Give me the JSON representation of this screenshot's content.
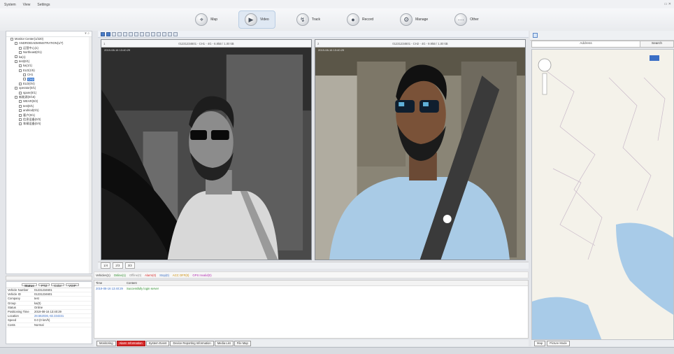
{
  "menu": {
    "items": [
      "System",
      "View",
      "Settings"
    ]
  },
  "nav": {
    "tabs": [
      {
        "label": "Map",
        "icon": "map-icon"
      },
      {
        "label": "Video",
        "icon": "video-icon",
        "active": true
      },
      {
        "label": "Track",
        "icon": "track-icon"
      },
      {
        "label": "Record",
        "icon": "record-icon"
      },
      {
        "label": "Manage",
        "icon": "manage-icon"
      },
      {
        "label": "Other",
        "icon": "other-icon"
      }
    ]
  },
  "tree": {
    "rows": [
      {
        "text": "Monitor Center(1/220)",
        "indent": 1
      },
      {
        "text": "ANDROIDADMINISTRATION(1/7)",
        "indent": 2
      },
      {
        "text": "运营中心(1)",
        "indent": 3
      },
      {
        "text": "Northeast(0/1)",
        "indent": 3
      },
      {
        "text": "ka(1)",
        "indent": 2
      },
      {
        "text": "test(0/1)",
        "indent": 2
      },
      {
        "text": "ka(1/1)",
        "indent": 3
      },
      {
        "text": "ELD(1/5)",
        "indent": 3
      },
      {
        "text": "CH1",
        "indent": 4
      },
      {
        "text": "CH2",
        "indent": 4,
        "selected": true
      },
      {
        "text": "ELD(0/4)",
        "indent": 3
      },
      {
        "text": "operator(0/1)",
        "indent": 2
      },
      {
        "text": "spare(0/1)",
        "indent": 3
      },
      {
        "text": "新能源(0/16)",
        "indent": 2
      },
      {
        "text": "WEAR(0/2)",
        "indent": 3
      },
      {
        "text": "test(0/1)",
        "indent": 3
      },
      {
        "text": "andriod(0/1)",
        "indent": 3
      },
      {
        "text": "客户(0/1)",
        "indent": 3
      },
      {
        "text": "信息设备(0/3)",
        "indent": 3
      },
      {
        "text": "车辆设备(0/4)",
        "indent": 3
      }
    ]
  },
  "info": {
    "tabs": [
      "Status",
      "PTZ",
      "Color",
      "VOIP"
    ],
    "rows": [
      {
        "k": "Vehicle Number",
        "v": "01231234601"
      },
      {
        "k": "Vehicle ID",
        "v": "01231234601"
      },
      {
        "k": "Company",
        "v": "test"
      },
      {
        "k": "Group",
        "v": "ka(0)"
      },
      {
        "k": "Status",
        "v": "Online"
      },
      {
        "k": "Positioning Time",
        "v": "2019-08-16 13:40:29"
      },
      {
        "k": "Location",
        "v": "28.562036,-82.334331",
        "link": true
      },
      {
        "k": "Speed",
        "v": "0.0 (0 km/h)"
      },
      {
        "k": "Costs",
        "v": "Normal"
      }
    ]
  },
  "cameras": [
    {
      "num": "1",
      "title": "01231234601 - CH1 - 4G - 6.8kB / 1.00 kB",
      "overlay": "2019-08-16 13:40:29",
      "mode": "gray"
    },
    {
      "num": "2",
      "title": "01231234601 - CH2 - 4G - 9.9kB / 1.00 kB",
      "overlay": "2019-08-16 13:40:29",
      "mode": "color"
    }
  ],
  "pager": {
    "tabs": [
      "1/4",
      "2/3",
      "3/3"
    ]
  },
  "legend": [
    {
      "t": "Vehicles(1)",
      "c": "#333333"
    },
    {
      "t": "Online(1)",
      "c": "#2a8a2a"
    },
    {
      "t": "Offline(0)",
      "c": "#888888"
    },
    {
      "t": "Alarm(0)",
      "c": "#d72b2b"
    },
    {
      "t": "Stop(0)",
      "c": "#3b6fc5"
    },
    {
      "t": "ACC OFF(0)",
      "c": "#cc8a00"
    },
    {
      "t": "GPS Invalid(0)",
      "c": "#b22cb2"
    }
  ],
  "log": {
    "headers": [
      "Time",
      "Content"
    ],
    "rows": [
      {
        "time": "2019-08-16 13:40:29",
        "content": "Successfully login server"
      }
    ]
  },
  "bottomtabs": [
    {
      "t": "Monitoring",
      "red": false
    },
    {
      "t": "Alarm Information",
      "red": true
    },
    {
      "t": "System Event",
      "red": false
    },
    {
      "t": "Device Reporting Information",
      "red": false
    },
    {
      "t": "Media List",
      "red": false
    },
    {
      "t": "File Map",
      "red": false
    }
  ],
  "map": {
    "address_label": "Address",
    "search_label": "Search",
    "tabs": [
      "Map",
      "Picture Mode"
    ]
  }
}
